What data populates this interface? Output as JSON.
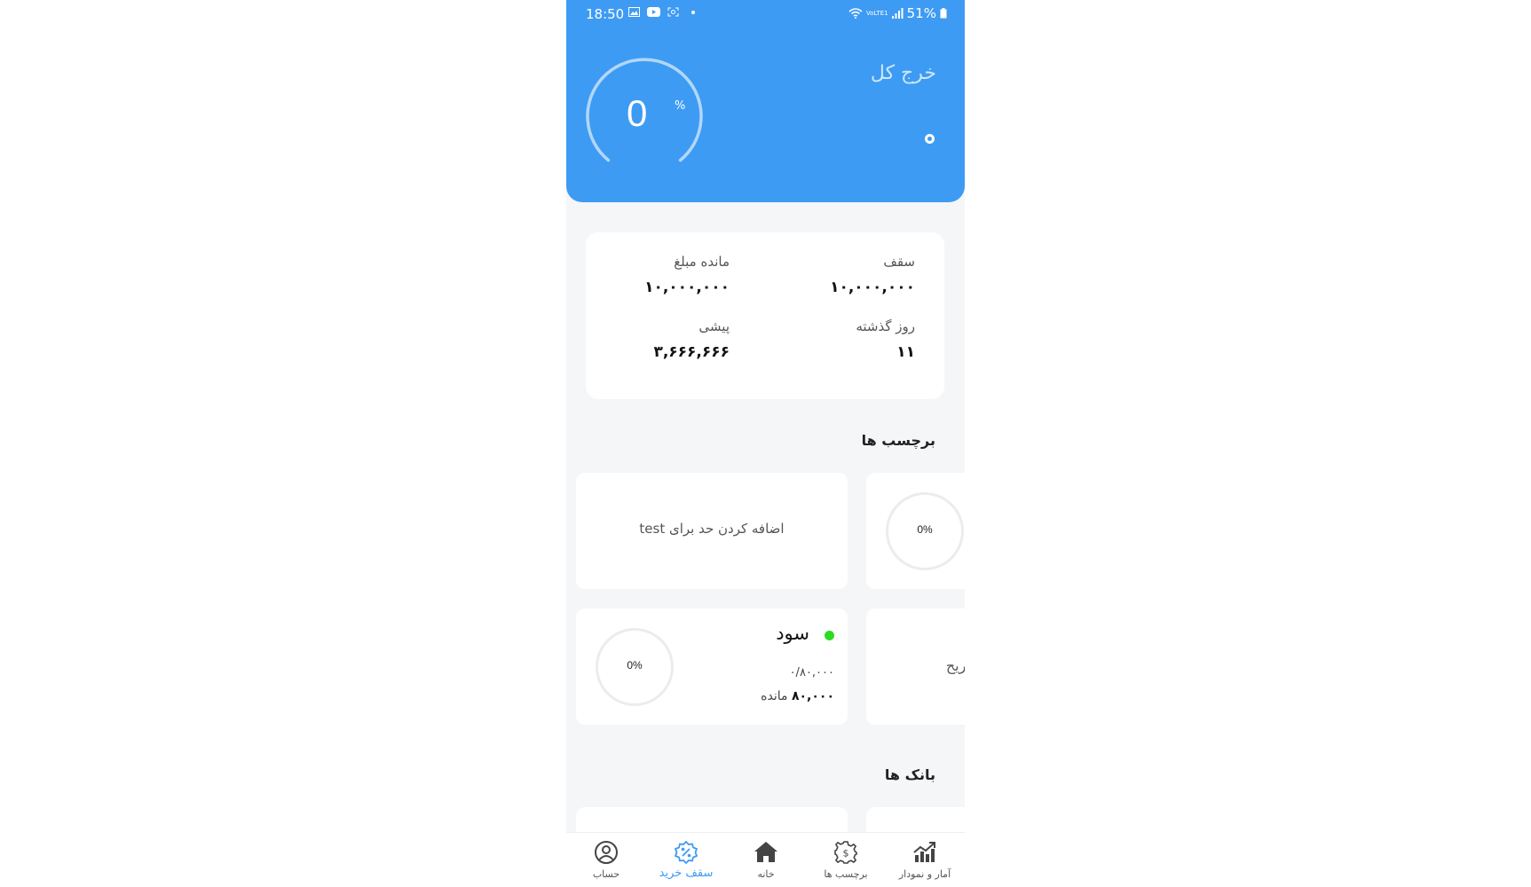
{
  "status_bar": {
    "time": "18:50",
    "network_label": "VoLTE1",
    "battery": "51%"
  },
  "header": {
    "title": "خرج کل",
    "gauge_value": "0",
    "gauge_unit": "%",
    "gauge_fraction": 0
  },
  "summary": {
    "limit_label": "سقف",
    "limit_value": "۱۰,۰۰۰,۰۰۰",
    "remaining_label": "مانده مبلغ",
    "remaining_value": "۱۰,۰۰۰,۰۰۰",
    "days_label": "روز گذشته",
    "days_value": "۱۱",
    "forecast_label": "پیشی",
    "forecast_value": "۳,۶۶۶,۶۶۶"
  },
  "tags_section": {
    "title": "برچسب ها",
    "add_limit_text": "اضافه کردن حد برای test",
    "card2_percent": "0%",
    "profit": {
      "name": "سود",
      "dot_color": "#2ddc22",
      "progress": "۰/۸۰,۰۰۰",
      "remaining_value": "۸۰,۰۰۰",
      "remaining_label": "مانده",
      "percent": "0%"
    },
    "card4_label": "تفریح"
  },
  "banks_section": {
    "title": "بانک ها"
  },
  "bottom_nav": {
    "items": [
      {
        "label": "حساب",
        "icon": "account-icon"
      },
      {
        "label": "سقف خرید",
        "icon": "percent-badge-icon",
        "active": true
      },
      {
        "label": "خانه",
        "icon": "home-icon"
      },
      {
        "label": "برچسب ها",
        "icon": "dollar-gear-icon"
      },
      {
        "label": "آمار و نمودار",
        "icon": "chart-trend-icon"
      }
    ]
  },
  "colors": {
    "primary": "#3e9bf3",
    "background": "#f5f6f8",
    "card": "#ffffff"
  }
}
